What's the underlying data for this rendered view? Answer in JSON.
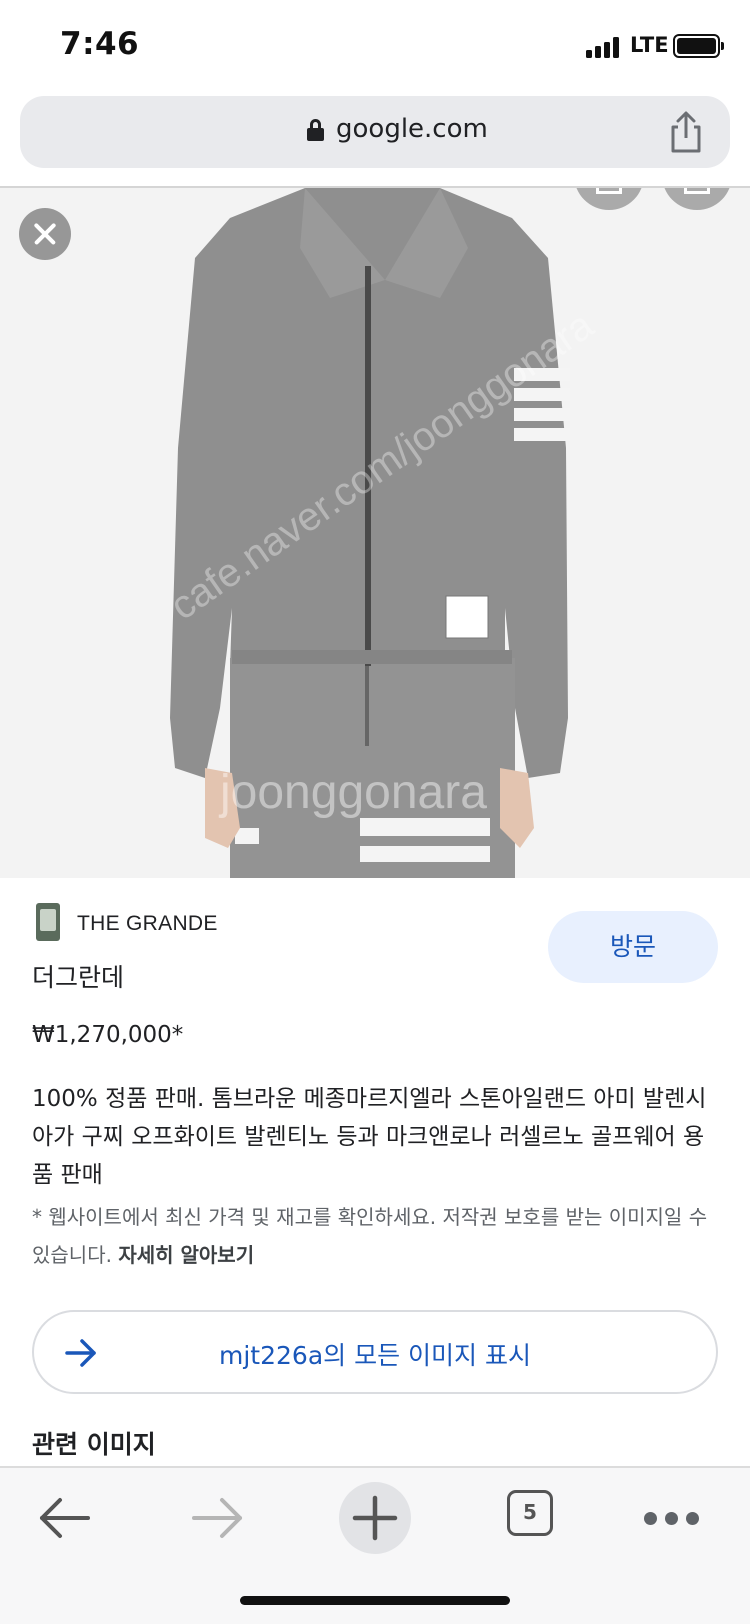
{
  "status_bar": {
    "time": "7:46",
    "network": "LTE"
  },
  "address_bar": {
    "url": "google.com",
    "icons": [
      "lock-icon",
      "share-icon"
    ]
  },
  "image_viewer": {
    "watermark": "joonggonara",
    "watermark2": "cafe.naver.com/joonggonara",
    "icons": [
      "close-icon",
      "save-icon",
      "bookmark-icon"
    ]
  },
  "result": {
    "source_name": "THE GRANDE",
    "visit_label": "방문",
    "title": "더그란데",
    "price": "₩1,270,000*",
    "description": "100% 정품 판매. 톰브라운 메종마르지엘라 스톤아일랜드 아미 발렌시아가 구찌 오프화이트 발렌티노 등과 마크앤로나 러셀르노 골프웨어 용품 판매",
    "note": "* 웹사이트에서 최신 가격 및 재고를 확인하세요. 저작권 보호를 받는 이미지일 수 있습니다.",
    "learn_more": "자세히 알아보기",
    "all_images_label": "mjt226a의 모든 이미지 표시",
    "related_heading": "관련 이미지"
  },
  "toolbar": {
    "tab_count": "5",
    "icons": [
      "back-arrow-icon",
      "forward-arrow-icon",
      "plus-icon",
      "tabs-icon",
      "more-icon"
    ]
  },
  "colors": {
    "link_blue": "#1a57b9",
    "visit_bg": "#e8f0fe",
    "jacket_gray": "#8f8f8f"
  }
}
